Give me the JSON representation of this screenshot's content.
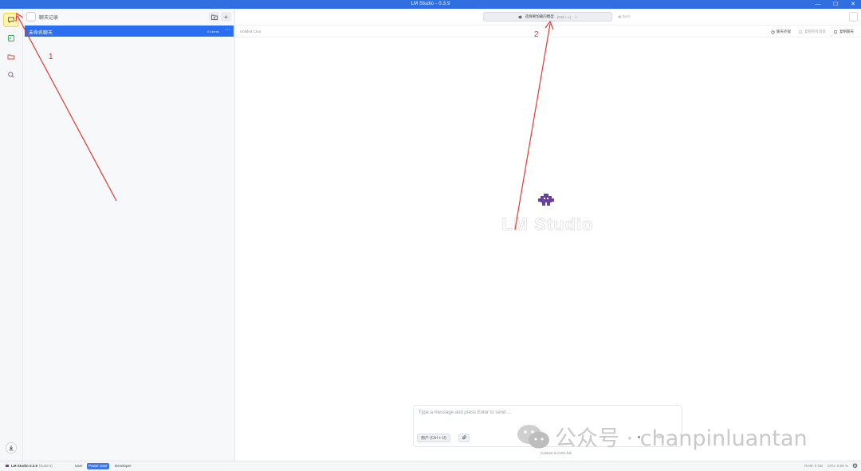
{
  "window": {
    "title": "LM Studio - 0.3.9",
    "minimize": "—",
    "maximize": "☐",
    "close": "✕"
  },
  "rail": {
    "items": [
      {
        "icon": "chat-icon",
        "active": true
      },
      {
        "icon": "terminal-icon",
        "active": false
      },
      {
        "icon": "folder-icon",
        "active": false
      },
      {
        "icon": "search-icon",
        "active": false
      }
    ],
    "download_icon": "download-icon"
  },
  "sidebar": {
    "header_label": "聊天记录",
    "chats": [
      {
        "name": "未命名聊天",
        "tokens": "0 tokens",
        "more": "⋯"
      }
    ]
  },
  "main": {
    "model_select": {
      "label": "选择要加载的模型",
      "shortcut": "(Ctrl + L)"
    },
    "eject_label": "⏏ Eject",
    "untitled": "Untitled Chat",
    "actions": {
      "settings": "聊天外观",
      "copy_disabled": "复制所有消息",
      "duplicate": "复制聊天"
    },
    "wordmark": "LM Studio"
  },
  "composer": {
    "placeholder": "Type a message and press Enter to send ...",
    "role_button": "用户 (Ctrl + U)",
    "insert_label": "Insert",
    "context_label": "Context is 0.0% full"
  },
  "statusbar": {
    "brand": "LM Studio 0.3.9",
    "build": "(Build 6)",
    "modes": [
      "User",
      "Power User",
      "Developer"
    ],
    "active_mode": "Power User",
    "ram": "RAM: 0 GB",
    "cpu": "CPU: 0.00 %"
  },
  "annotations": {
    "one": "1",
    "two": "2"
  },
  "watermark": {
    "text": "公众号 · chanpinluantan"
  },
  "colors": {
    "accent": "#2a6ff0",
    "titlebar": "#2f6fe0",
    "annotation": "#d93025",
    "active_rail": "#fff4b8"
  }
}
